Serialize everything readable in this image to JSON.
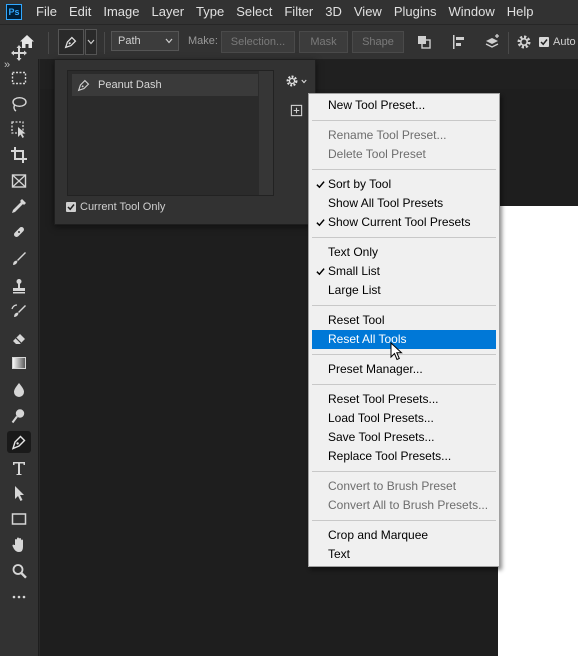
{
  "app": {
    "logo_text": "Ps",
    "menus": [
      "File",
      "Edit",
      "Image",
      "Layer",
      "Type",
      "Select",
      "Filter",
      "3D",
      "View",
      "Plugins",
      "Window",
      "Help"
    ]
  },
  "options_bar": {
    "mode_dropdown": "Path",
    "make_label": "Make:",
    "selection_button": "Selection...",
    "mask_button": "Mask",
    "shape_button": "Shape",
    "auto_label": "Auto"
  },
  "toolbar": {
    "collapse_label": "»",
    "tools": [
      {
        "name": "move-tool",
        "icon": "move-icon"
      },
      {
        "name": "marquee-tool",
        "icon": "marquee-icon"
      },
      {
        "name": "lasso-tool",
        "icon": "lasso-icon"
      },
      {
        "name": "object-selection-tool",
        "icon": "object-selection-icon"
      },
      {
        "name": "crop-tool",
        "icon": "crop-icon"
      },
      {
        "name": "frame-tool",
        "icon": "frame-icon"
      },
      {
        "name": "eyedropper-tool",
        "icon": "eyedropper-icon"
      },
      {
        "name": "healing-brush-tool",
        "icon": "bandage-icon"
      },
      {
        "name": "brush-tool",
        "icon": "brush-icon"
      },
      {
        "name": "clone-stamp-tool",
        "icon": "stamp-icon"
      },
      {
        "name": "history-brush-tool",
        "icon": "history-brush-icon"
      },
      {
        "name": "eraser-tool",
        "icon": "eraser-icon"
      },
      {
        "name": "gradient-tool",
        "icon": "gradient-icon"
      },
      {
        "name": "blur-tool",
        "icon": "blur-icon"
      },
      {
        "name": "dodge-tool",
        "icon": "dodge-icon"
      },
      {
        "name": "pen-tool",
        "icon": "pen-icon"
      },
      {
        "name": "type-tool",
        "icon": "type-icon"
      },
      {
        "name": "path-selection-tool",
        "icon": "arrow-icon"
      },
      {
        "name": "rectangle-tool",
        "icon": "rectangle-icon"
      },
      {
        "name": "hand-tool",
        "icon": "hand-icon"
      },
      {
        "name": "zoom-tool",
        "icon": "zoom-icon"
      },
      {
        "name": "more-tools",
        "icon": "ellipsis-icon"
      }
    ]
  },
  "preset_panel": {
    "presets": [
      {
        "label": "Peanut Dash"
      }
    ],
    "current_tool_only_label": "Current Tool Only",
    "current_tool_only_checked": true
  },
  "context_menu": {
    "groups": [
      [
        {
          "label": "New Tool Preset...",
          "enabled": true,
          "checked": false
        }
      ],
      [
        {
          "label": "Rename Tool Preset...",
          "enabled": false,
          "checked": false
        },
        {
          "label": "Delete Tool Preset",
          "enabled": false,
          "checked": false
        }
      ],
      [
        {
          "label": "Sort by Tool",
          "enabled": true,
          "checked": true
        },
        {
          "label": "Show All Tool Presets",
          "enabled": true,
          "checked": false
        },
        {
          "label": "Show Current Tool Presets",
          "enabled": true,
          "checked": true
        }
      ],
      [
        {
          "label": "Text Only",
          "enabled": true,
          "checked": false
        },
        {
          "label": "Small List",
          "enabled": true,
          "checked": true
        },
        {
          "label": "Large List",
          "enabled": true,
          "checked": false
        }
      ],
      [
        {
          "label": "Reset Tool",
          "enabled": true,
          "checked": false
        },
        {
          "label": "Reset All Tools",
          "enabled": true,
          "checked": false,
          "highlighted": true
        }
      ],
      [
        {
          "label": "Preset Manager...",
          "enabled": true,
          "checked": false
        }
      ],
      [
        {
          "label": "Reset Tool Presets...",
          "enabled": true,
          "checked": false
        },
        {
          "label": "Load Tool Presets...",
          "enabled": true,
          "checked": false
        },
        {
          "label": "Save Tool Presets...",
          "enabled": true,
          "checked": false
        },
        {
          "label": "Replace Tool Presets...",
          "enabled": true,
          "checked": false
        }
      ],
      [
        {
          "label": "Convert to Brush Preset",
          "enabled": false,
          "checked": false
        },
        {
          "label": "Convert All to Brush Presets...",
          "enabled": false,
          "checked": false
        }
      ],
      [
        {
          "label": "Crop and Marquee",
          "enabled": true,
          "checked": false
        },
        {
          "label": "Text",
          "enabled": true,
          "checked": false
        }
      ]
    ]
  },
  "colors": {
    "highlight": "#0078d7",
    "chrome": "#323232",
    "canvas_dark": "#1e1e1e",
    "menu_bg": "#f0f0f0",
    "ps_blue": "#31a8ff"
  }
}
